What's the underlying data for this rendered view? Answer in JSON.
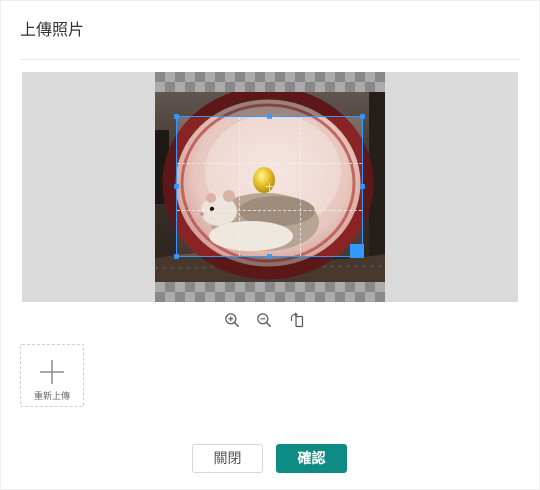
{
  "dialog": {
    "title": "上傳照片"
  },
  "cropper": {
    "toolbar": {
      "zoom_in_icon": "zoom-in-icon",
      "zoom_out_icon": "zoom-out-icon",
      "rotate_icon": "rotate-icon"
    }
  },
  "uploader": {
    "icon": "plus-icon",
    "label": "重新上傳"
  },
  "footer": {
    "close_label": "關閉",
    "confirm_label": "確認"
  },
  "colors": {
    "accent": "#0e8c84",
    "crop_border": "#3399ff",
    "text": "#333333"
  }
}
